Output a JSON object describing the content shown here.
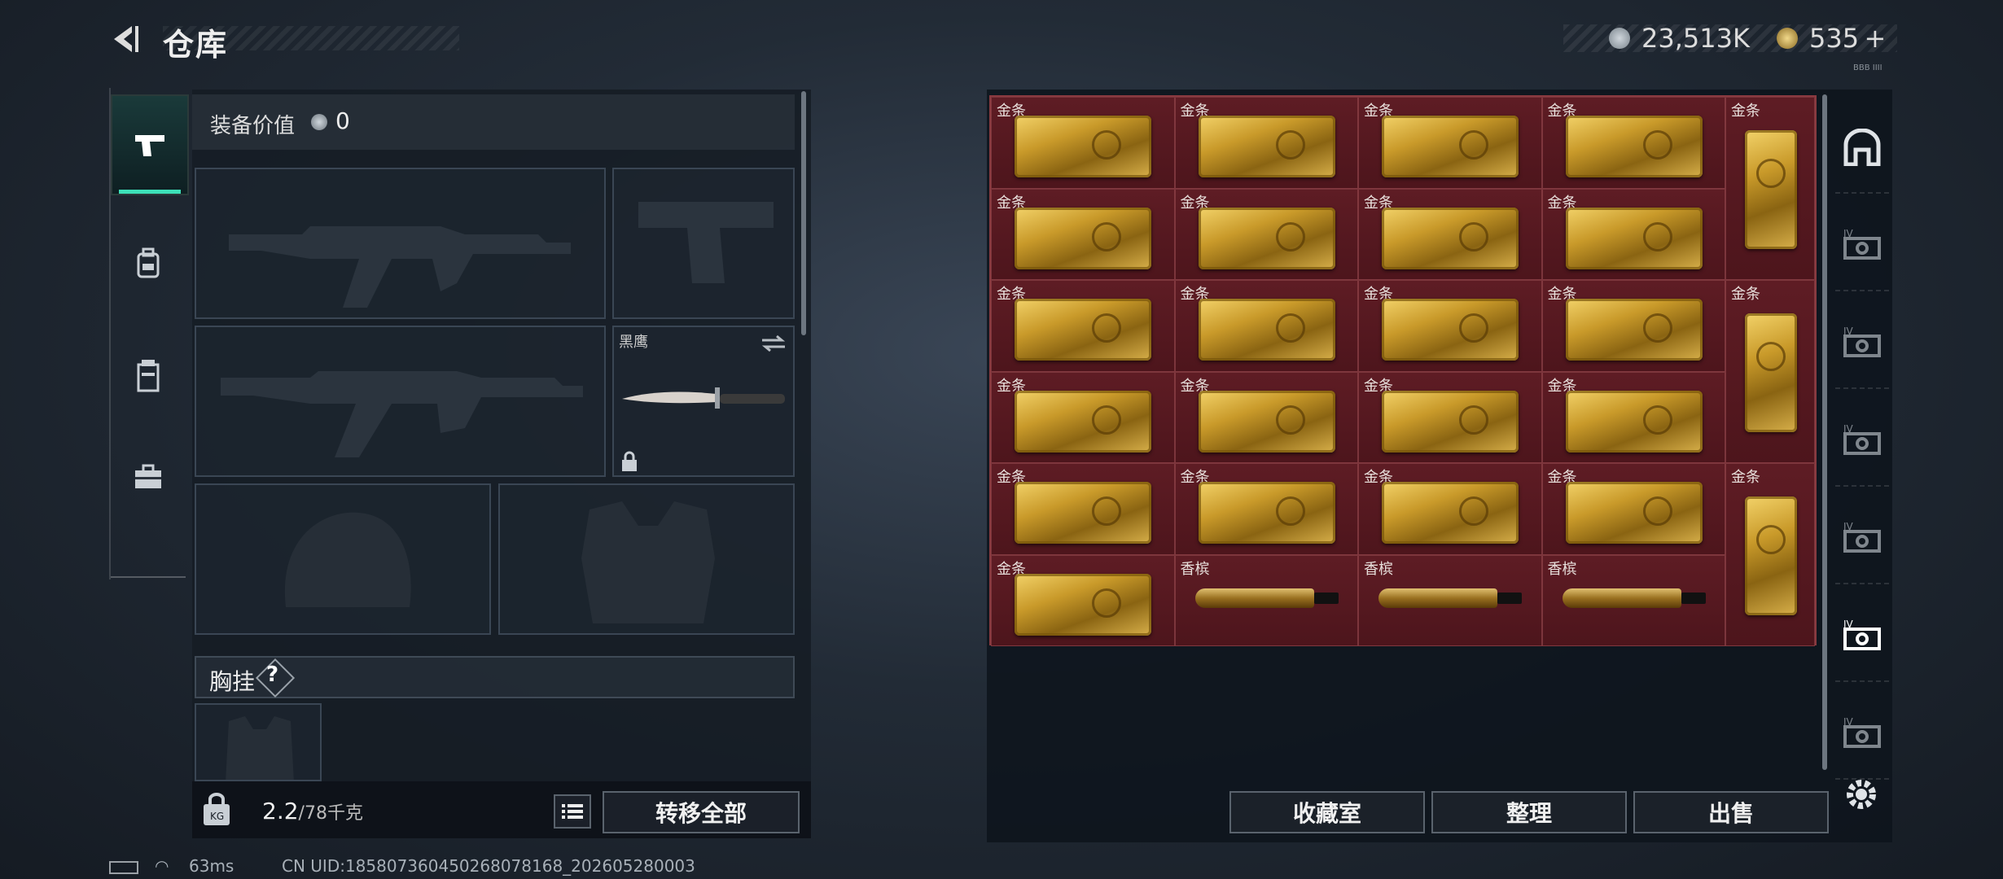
{
  "header": {
    "title": "仓库",
    "currency_primary": "23,513K",
    "currency_secondary": "535 +",
    "mini_text": "BBB IIII"
  },
  "left_tabs": [
    {
      "name": "weapons",
      "icon": "pistol-icon",
      "active": true
    },
    {
      "name": "backpack",
      "icon": "backpack-icon",
      "active": false
    },
    {
      "name": "case",
      "icon": "container-icon",
      "active": false
    },
    {
      "name": "toolbox",
      "icon": "toolbox-icon",
      "active": false
    }
  ],
  "equipment": {
    "value_label": "装备价值",
    "value": "0",
    "knife_label": "黑鹰",
    "chest_rig_label": "胸挂",
    "help_symbol": "?"
  },
  "bottom": {
    "weight_current": "2.2",
    "weight_max": "/78千克",
    "transfer_all": "转移全部"
  },
  "storage": {
    "items": [
      {
        "label": "金条",
        "type": "gold"
      },
      {
        "label": "金条",
        "type": "gold"
      },
      {
        "label": "金条",
        "type": "gold"
      },
      {
        "label": "金条",
        "type": "gold"
      },
      {
        "label": "金条",
        "type": "gold"
      },
      {
        "label": "金条",
        "type": "gold"
      },
      {
        "label": "金条",
        "type": "gold"
      },
      {
        "label": "金条",
        "type": "gold"
      },
      {
        "label": "金条",
        "type": "gold"
      },
      {
        "label": "金条",
        "type": "gold"
      },
      {
        "label": "金条",
        "type": "gold"
      },
      {
        "label": "金条",
        "type": "gold"
      },
      {
        "label": "金条",
        "type": "gold"
      },
      {
        "label": "金条",
        "type": "gold"
      },
      {
        "label": "金条",
        "type": "gold"
      },
      {
        "label": "金条",
        "type": "gold"
      },
      {
        "label": "金条",
        "type": "gold"
      },
      {
        "label": "金条",
        "type": "gold"
      },
      {
        "label": "金条",
        "type": "gold"
      },
      {
        "label": "金条",
        "type": "gold"
      },
      {
        "label": "金条",
        "type": "gold"
      },
      {
        "label": "香槟",
        "type": "champagne"
      },
      {
        "label": "香槟",
        "type": "champagne"
      },
      {
        "label": "香槟",
        "type": "champagne"
      }
    ],
    "vertical_items": [
      {
        "label": "金条",
        "type": "gold"
      },
      {
        "label": "金条",
        "type": "gold"
      },
      {
        "label": "金条",
        "type": "gold"
      }
    ]
  },
  "actions": {
    "collection": "收藏室",
    "organize": "整理",
    "sell": "出售"
  },
  "right_tabs": [
    {
      "icon": "house-icon"
    },
    {
      "icon": "storage-box-icon"
    },
    {
      "icon": "storage-box-icon"
    },
    {
      "icon": "storage-box-icon"
    },
    {
      "icon": "storage-box-icon"
    },
    {
      "icon": "storage-box-icon"
    },
    {
      "icon": "storage-box-icon"
    }
  ],
  "status_bar": {
    "ping": "63ms",
    "uid": "CN UID:185807360450268078168_202605280003"
  },
  "colors": {
    "accent": "#3de0b8",
    "storage_bg": "#5a1a22"
  }
}
